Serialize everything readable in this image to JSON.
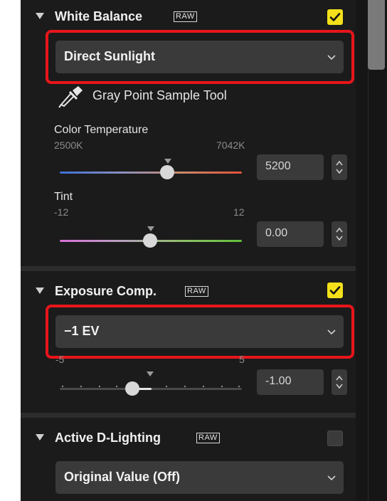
{
  "white_balance": {
    "title": "White Balance",
    "raw_badge": "RAW",
    "enabled": true,
    "preset": "Direct Sunlight",
    "sample_tool_label": "Gray Point Sample Tool",
    "color_temperature": {
      "label": "Color Temperature",
      "min_label": "2500K",
      "max_label": "7042K",
      "value": "5200",
      "position": 0.62
    },
    "tint": {
      "label": "Tint",
      "min_label": "-12",
      "max_label": "12",
      "value": "0.00",
      "position": 0.5
    }
  },
  "exposure_comp": {
    "title": "Exposure Comp.",
    "raw_badge": "RAW",
    "enabled": true,
    "preset": "−1 EV",
    "min_label": "-5",
    "max_label": "5",
    "value": "-1.00",
    "position": 0.4
  },
  "active_d_lighting": {
    "title": "Active D-Lighting",
    "raw_badge": "RAW",
    "enabled": false,
    "preset": "Original Value (Off)"
  },
  "colors": {
    "accent_checkbox": "#f4e01a",
    "highlight_outline": "#e8151a",
    "panel_background": "#1b1b1b"
  }
}
